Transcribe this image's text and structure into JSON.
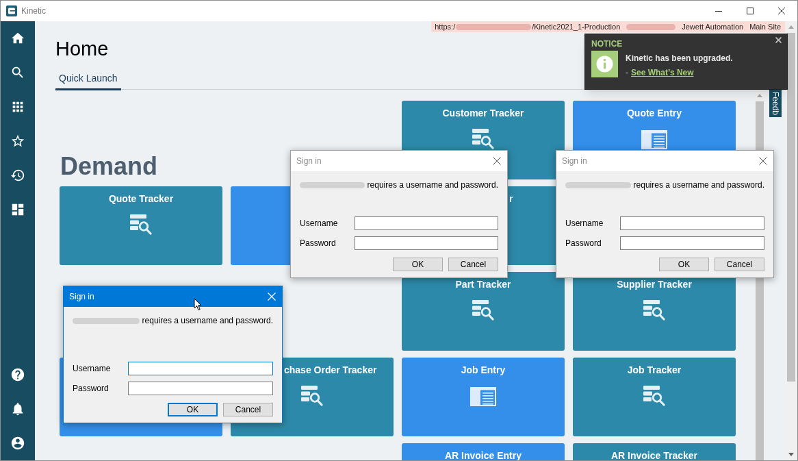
{
  "window": {
    "title": "Kinetic"
  },
  "url_banner": {
    "url_parts": [
      {
        "kind": "text",
        "text": "https:/"
      },
      {
        "kind": "redacted"
      },
      {
        "kind": "text",
        "text": "/Kinetic2021_1-Production"
      }
    ],
    "context": [
      {
        "kind": "redacted"
      },
      {
        "kind": "text",
        "text": "Jewett Automation"
      },
      {
        "kind": "text",
        "text": "Main Site"
      }
    ]
  },
  "page": {
    "title": "Home"
  },
  "tabs": [
    {
      "label": "Quick Launch",
      "selected": true
    }
  ],
  "quick_launch": {
    "heading": "Demand",
    "tiles": [
      {
        "label": "Customer Tracker",
        "kind": "tracker"
      },
      {
        "label": "Quote Entry",
        "kind": "entry"
      },
      {
        "label": "Quote Tracker",
        "kind": "tracker"
      },
      {
        "kind": "entry"
      },
      {
        "label": "r",
        "kind": "tracker"
      },
      {
        "label": "Part Tracker",
        "kind": "tracker"
      },
      {
        "label": "Supplier Tracker",
        "kind": "tracker"
      },
      {
        "kind": "entry"
      },
      {
        "label": "chase Order Tracker",
        "kind": "tracker"
      },
      {
        "label": "Job Entry",
        "kind": "entry"
      },
      {
        "label": "Job Tracker",
        "kind": "tracker"
      },
      {
        "label": "AR Invoice Entry",
        "kind": "entry"
      },
      {
        "label": "AR Invoice Tracker",
        "kind": "tracker"
      }
    ]
  },
  "notice": {
    "title": "NOTICE",
    "message": "Kinetic has been upgraded.",
    "link_prefix": "-",
    "link": "See What’s New"
  },
  "feedback_tab": {
    "label": "Feedb"
  },
  "dialogs": [
    {
      "title": "Sign in",
      "active": false,
      "message": [
        {
          "kind": "redacted"
        },
        {
          "kind": "text",
          "text": "requires a username and password."
        }
      ],
      "fields": [
        {
          "label": "Username",
          "focused": false
        },
        {
          "label": "Password",
          "focused": false
        }
      ],
      "buttons": [
        {
          "label": "OK",
          "focused": false
        },
        {
          "label": "Cancel",
          "focused": false
        }
      ]
    },
    {
      "title": "Sign in",
      "active": false,
      "message": [
        {
          "kind": "redacted"
        },
        {
          "kind": "text",
          "text": "requires a username and password."
        }
      ],
      "fields": [
        {
          "label": "Username",
          "focused": false
        },
        {
          "label": "Password",
          "focused": false
        }
      ],
      "buttons": [
        {
          "label": "OK",
          "focused": false
        },
        {
          "label": "Cancel",
          "focused": false
        }
      ]
    },
    {
      "title": "Sign in",
      "active": true,
      "message": [
        {
          "kind": "redacted"
        },
        {
          "kind": "text",
          "text": "requires a username and password."
        }
      ],
      "fields": [
        {
          "label": "Username",
          "focused": true
        },
        {
          "label": "Password",
          "focused": false
        }
      ],
      "buttons": [
        {
          "label": "OK",
          "focused": true
        },
        {
          "label": "Cancel",
          "focused": false
        }
      ]
    }
  ]
}
